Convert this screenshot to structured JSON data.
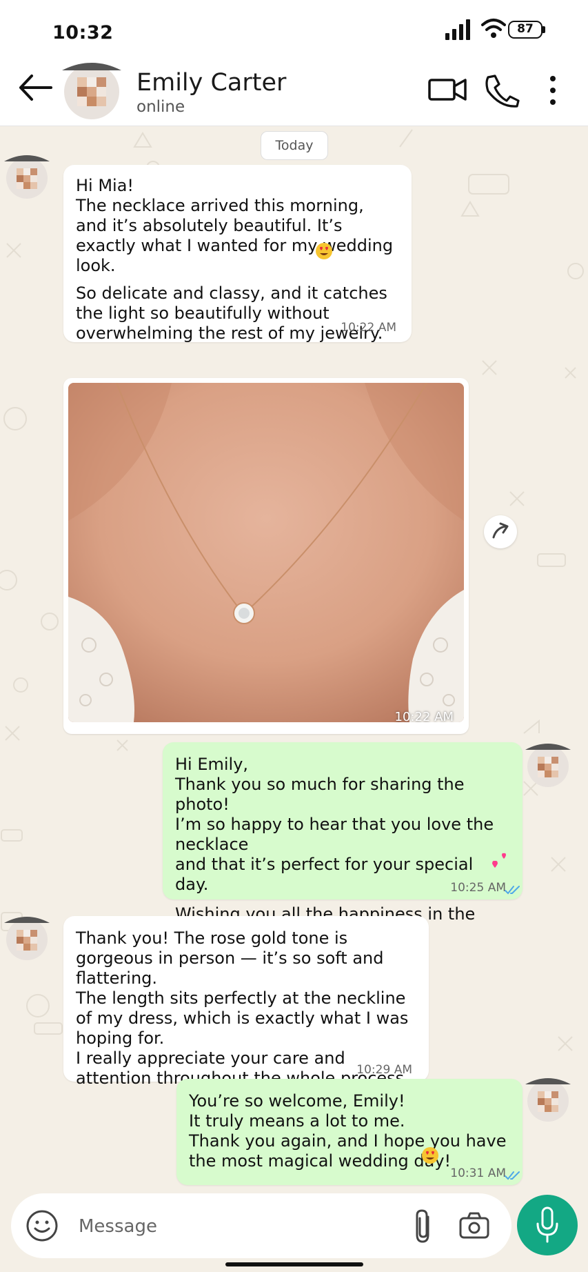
{
  "status_bar": {
    "time": "10:32",
    "battery": "87"
  },
  "header": {
    "name": "Emily Carter",
    "status": "online"
  },
  "chat": {
    "date_chip": "Today",
    "messages": [
      {
        "from": "Emily",
        "paragraph1": "Hi Mia!\nThe necklace arrived this morning, and it’s absolutely beautiful. It’s exactly what I wanted for my wedding look.",
        "paragraph2": "So delicate and classy, and it catches the light so beautifully without overwhelming the rest of my jewelry.",
        "time": "10:22 AM"
      },
      {
        "from": "Emily",
        "type": "image",
        "time": "10:22 AM"
      },
      {
        "from": "Mia",
        "paragraph1": "Hi Emily,\nThank you so much for sharing the photo!\nI’m so happy to hear that you love the necklace\nand that it’s perfect for your special day.",
        "paragraph2": "Wishing you all the happiness in the world!",
        "time": "10:25 AM"
      },
      {
        "from": "Emily",
        "paragraph1": "Thank you! The rose gold tone is gorgeous in person — it’s so soft and flattering.\nThe length sits perfectly at the neckline of my dress, which is exactly what I was hoping for.\nI really appreciate your care and attention throughout the whole process.",
        "time": "10:29 AM"
      },
      {
        "from": "Mia",
        "paragraph1": "You’re so welcome, Emily!\nIt truly means a lot to me.\nThank you again, and I hope you have the most magical wedding day!",
        "time": "10:31 AM"
      }
    ]
  },
  "composer": {
    "placeholder": "Message"
  },
  "colors": {
    "outgoing": "#d7fbcd",
    "incoming": "#ffffff",
    "accent": "#13a884",
    "background": "#f4efe6",
    "read_ticks": "#4fa8e8"
  },
  "icons": [
    "back-arrow-icon",
    "video-call-icon",
    "phone-icon",
    "more-vert-icon",
    "emoji-icon",
    "attach-icon",
    "camera-icon",
    "mic-icon",
    "forward-icon",
    "heart-eyes-emoji",
    "hearts-emoji",
    "double-check-icon"
  ]
}
